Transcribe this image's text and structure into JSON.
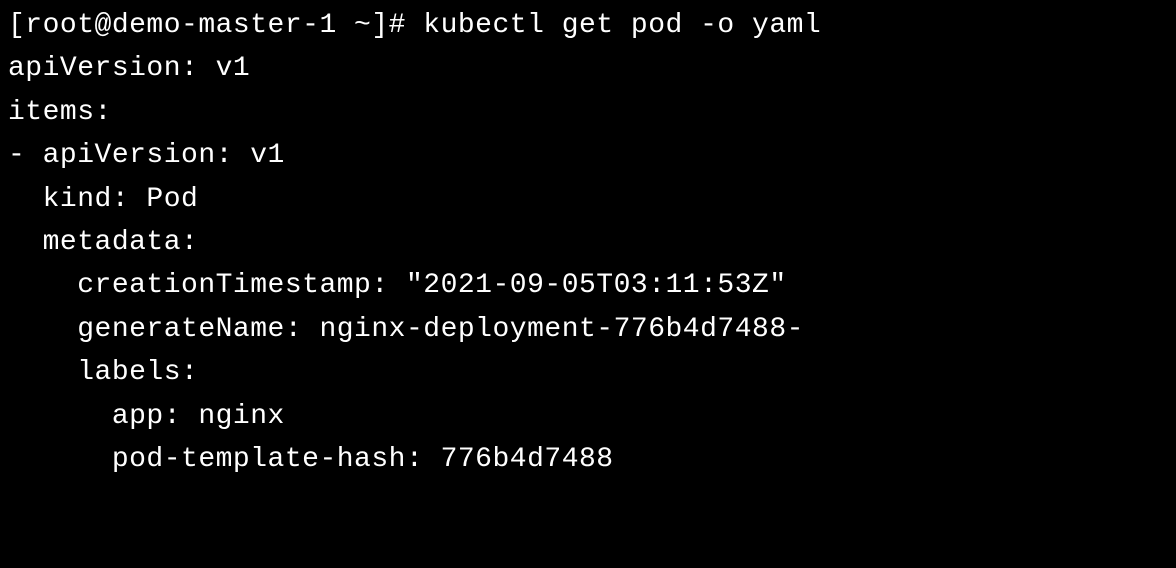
{
  "terminal": {
    "line1": "[root@demo-master-1 ~]# kubectl get pod -o yaml",
    "line2": "apiVersion: v1",
    "line3": "items:",
    "line4": "- apiVersion: v1",
    "line5": "  kind: Pod",
    "line6": "  metadata:",
    "line7": "    creationTimestamp: \"2021-09-05T03:11:53Z\"",
    "line8": "    generateName: nginx-deployment-776b4d7488-",
    "line9": "    labels:",
    "line10": "      app: nginx",
    "line11": "      pod-template-hash: 776b4d7488"
  }
}
